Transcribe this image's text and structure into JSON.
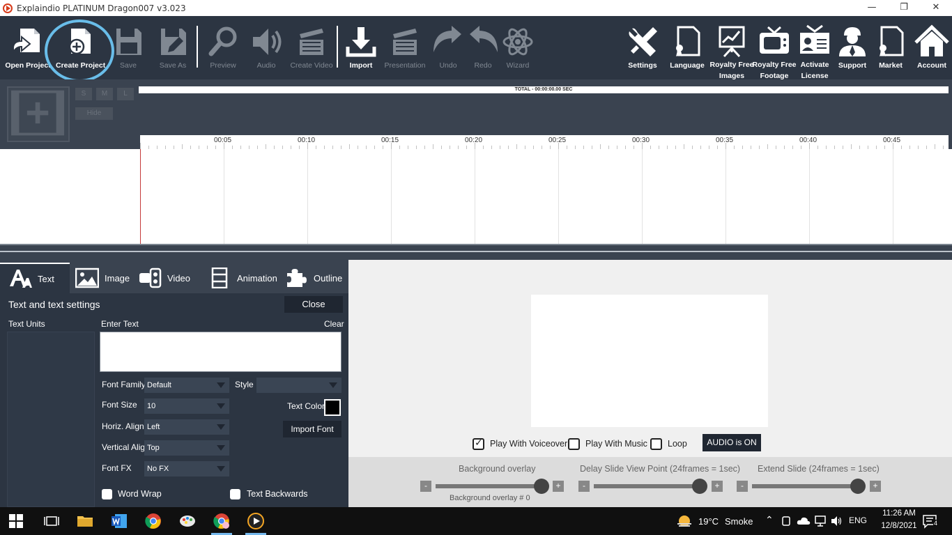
{
  "window": {
    "title": "Explaindio PLATINUM Dragon007 v3.023",
    "minimize": "—",
    "restore": "❐",
    "close": "✕"
  },
  "toolbar": {
    "open_project": "Open Project",
    "create_project": "Create Project",
    "save": "Save",
    "save_as": "Save As",
    "preview": "Preview",
    "audio": "Audio",
    "create_video": "Create Video",
    "import": "Import",
    "presentation": "Presentation",
    "undo": "Undo",
    "redo": "Redo",
    "wizard": "Wizard",
    "settings": "Settings",
    "language": "Language",
    "royalty_images_1": "Royalty Free",
    "royalty_images_2": "Images",
    "royalty_footage_1": "Royalty Free",
    "royalty_footage_2": "Footage",
    "activate_1": "Activate",
    "activate_2": "License",
    "support": "Support",
    "market": "Market",
    "account": "Account"
  },
  "timeline": {
    "size_s": "S",
    "size_m": "M",
    "size_l": "L",
    "hide": "Hide",
    "total": "TOTAL -  00:00:00.00 SEC",
    "ruler_labels": [
      "00:05",
      "00:10",
      "00:15",
      "00:20",
      "00:25",
      "00:30",
      "00:35",
      "00:40",
      "00:45"
    ]
  },
  "tabs": {
    "text": "Text",
    "image": "Image",
    "video": "Video",
    "animation": "Animation",
    "outline": "Outline"
  },
  "text_panel": {
    "title": "Text and text settings",
    "close": "Close",
    "text_units": "Text Units",
    "enter_text": "Enter Text",
    "clear": "Clear",
    "font_family_label": "Font Family",
    "font_family_value": "Default",
    "style_label": "Style",
    "style_value": "",
    "font_size_label": "Font Size",
    "font_size_value": "10",
    "text_color_label": "Text Color",
    "text_color": "#000000",
    "horiz_align_label": "Horiz. Align",
    "horiz_align_value": "Left",
    "import_font": "Import Font",
    "vertical_align_label": "Vertical Align",
    "vertical_align_value": "Top",
    "font_fx_label": "Font FX",
    "font_fx_value": "No FX",
    "word_wrap": "Word Wrap",
    "text_backwards": "Text Backwards"
  },
  "preview": {
    "play_with_voiceover": "Play With Voiceover",
    "play_with_voiceover_checked": true,
    "play_with_music": "Play With Music",
    "play_with_music_checked": false,
    "loop": "Loop",
    "loop_checked": false,
    "audio_button": "AUDIO is ON"
  },
  "sliders": {
    "background_overlay": "Background overlay",
    "background_overlay_note": "Background overlay  # 0",
    "delay": "Delay Slide View Point (24frames = 1sec)",
    "extend": "Extend Slide (24frames = 1sec)",
    "minus": "-",
    "plus": "+"
  },
  "taskbar": {
    "temperature": "19°C",
    "weather": "Smoke",
    "language": "ENG",
    "time": "11:26 AM",
    "date": "12/8/2021",
    "notifications": "4"
  },
  "colors": {
    "toolbar_bg": "#2c3542",
    "panel_bg": "#3a4350",
    "highlight": "#69bde9",
    "playhead": "#c43a3a"
  }
}
